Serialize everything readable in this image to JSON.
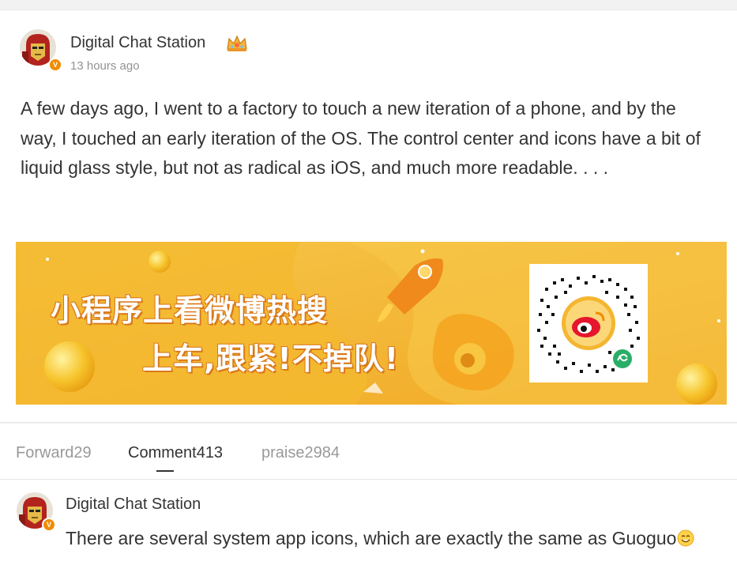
{
  "post": {
    "author": "Digital Chat Station",
    "time": "13 hours ago",
    "text": "A few days ago, I went to a factory to touch a new iteration of a phone, and by the way, I touched an early iteration of the OS. The control center and icons have a bit of liquid glass style, but not as radical as iOS, and much more readable. . . .",
    "verified_badge": "V",
    "accent_color": "#f08c00"
  },
  "banner": {
    "line1": "小程序上看微博热搜",
    "line2": "上车,跟紧!不掉队!",
    "background_color": "#f3b72d"
  },
  "tabs": [
    {
      "label": "Forward29",
      "active": false
    },
    {
      "label": "Comment413",
      "active": true
    },
    {
      "label": "praise2984",
      "active": false
    }
  ],
  "comment": {
    "author": "Digital Chat Station",
    "text": "There are several system app icons, which are exactly the same as Guoguo",
    "emoji": "smile-emoji-icon"
  }
}
